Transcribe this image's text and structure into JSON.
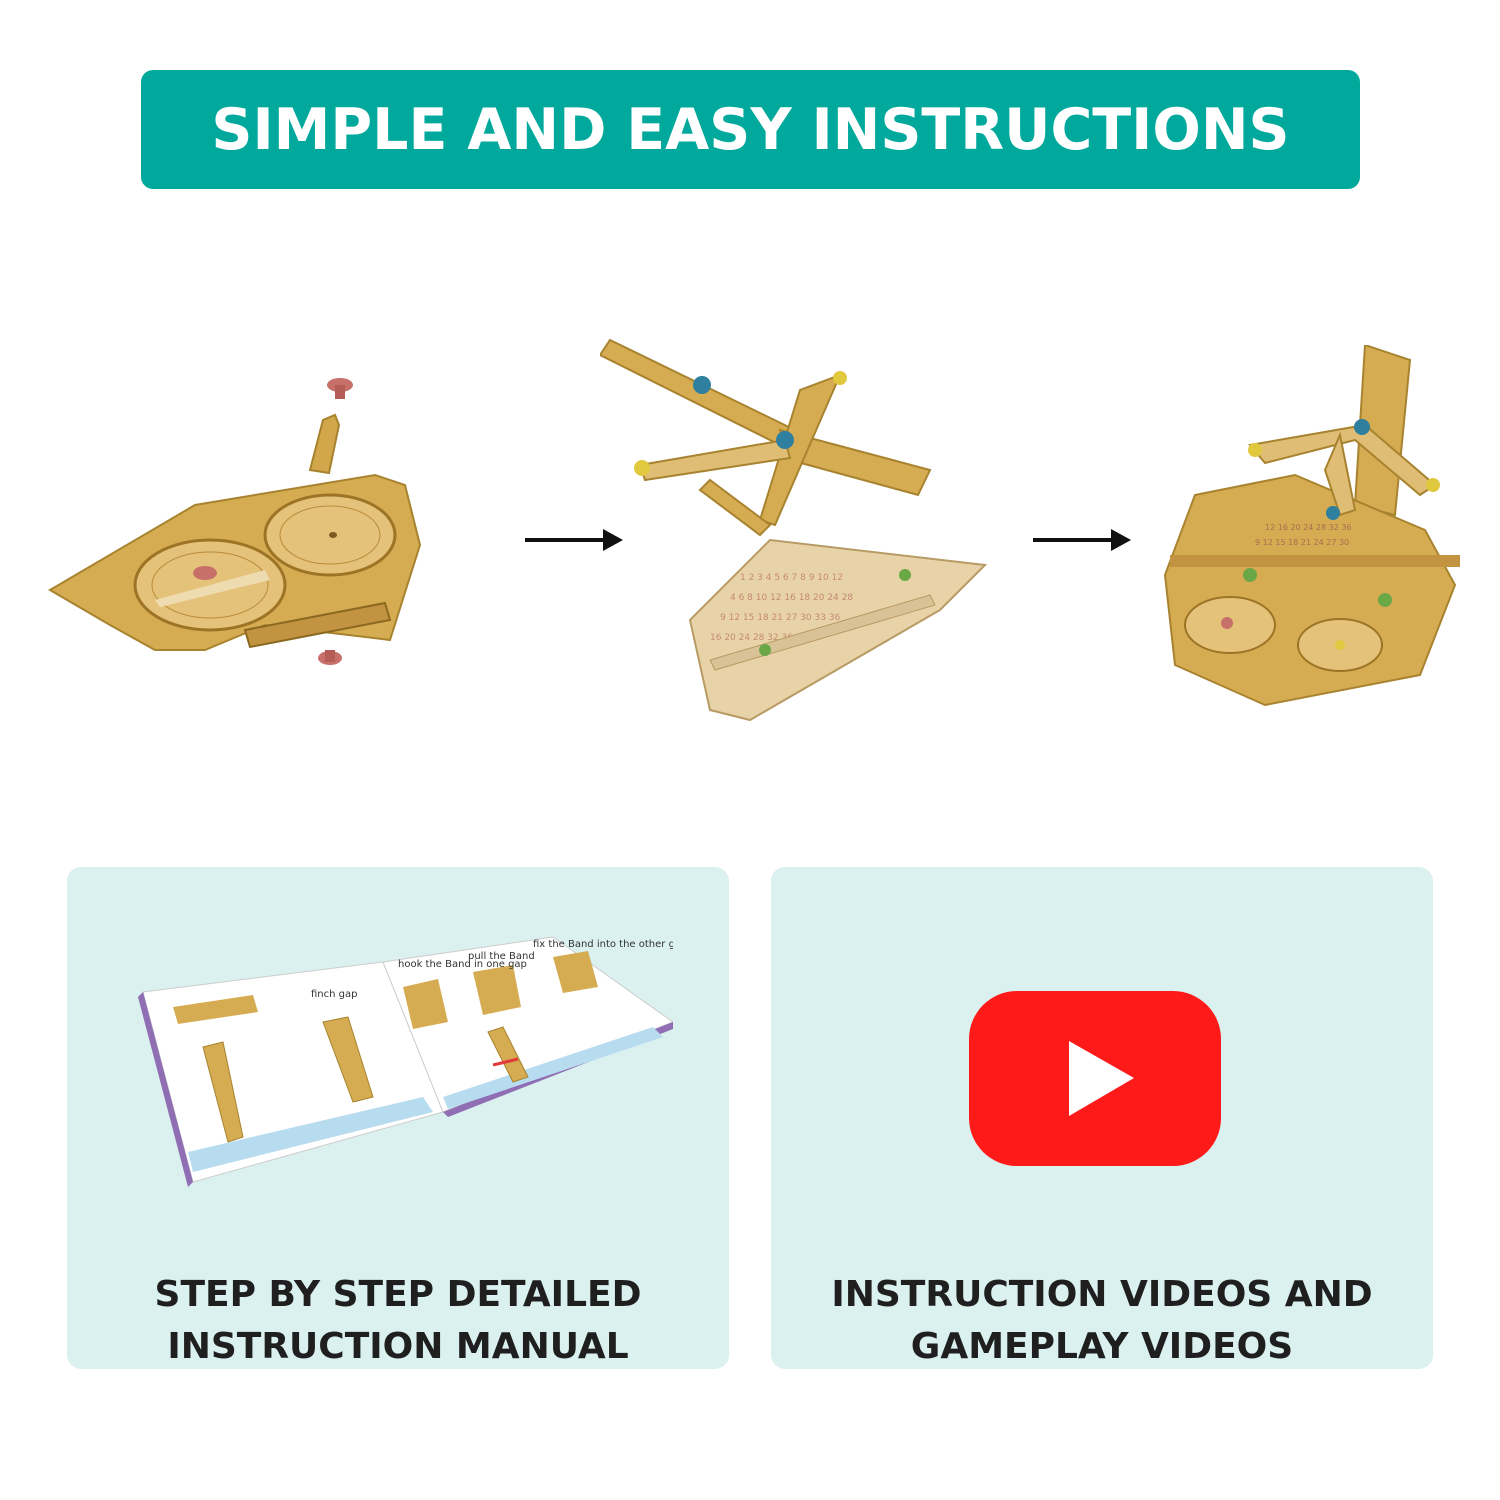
{
  "header": {
    "title": "SIMPLE AND EASY INSTRUCTIONS"
  },
  "steps": [
    {
      "icon": "wooden-dial-board-parts-icon"
    },
    {
      "icon": "wooden-lever-arms-and-scale-icon"
    },
    {
      "icon": "assembled-wooden-game-icon"
    }
  ],
  "cards": {
    "manual": {
      "line1": "STEP BY STEP DETAILED",
      "line2": "INSTRUCTION MANUAL",
      "icon": "instruction-booklet-icon",
      "booklet": {
        "left_label": "finch gap",
        "right_label1": "hook the Band in one gap",
        "right_label2": "pull the Band",
        "right_label3": "fix the Band into the other gap"
      }
    },
    "videos": {
      "line1": "INSTRUCTION VIDEOS AND",
      "line2": "GAMEPLAY VIDEOS",
      "icon": "youtube-play-icon"
    }
  },
  "colors": {
    "banner": "#01a99c",
    "card_bg": "#dbf1f0",
    "wood": "#d2a64a",
    "youtube_red": "#ff0000"
  }
}
